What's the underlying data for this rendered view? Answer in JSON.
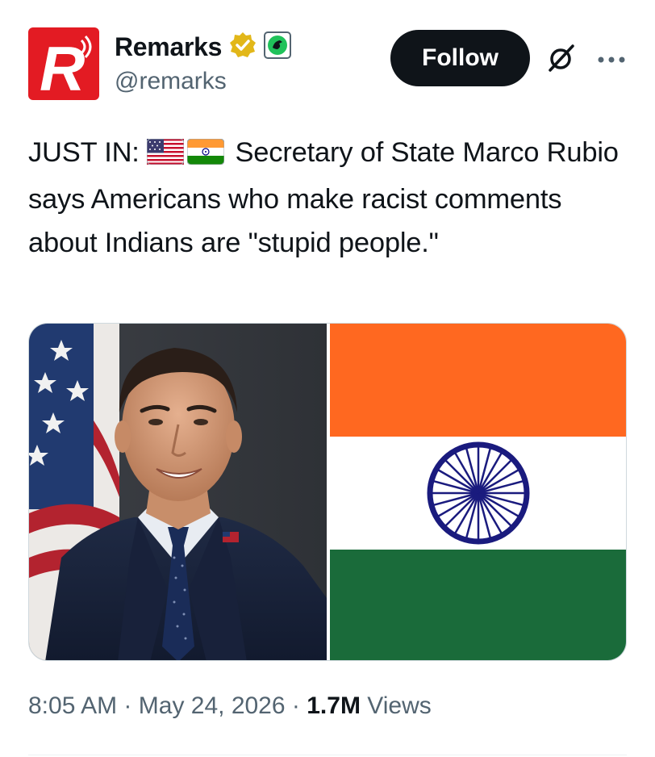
{
  "author": {
    "display_name": "Remarks",
    "handle": "@remarks",
    "avatar_letter": "R"
  },
  "actions": {
    "follow_label": "Follow",
    "grok_icon": "grok-slash-icon",
    "more_icon": "more-dots-icon"
  },
  "tweet": {
    "prefix": "JUST IN:",
    "body": "Secretary of State Marco Rubio says Americans who make racist comments about Indians are \"stupid people.\"",
    "flags": [
      "us-flag-icon",
      "india-flag-icon"
    ]
  },
  "media": {
    "left": "portrait photo",
    "right": "india-flag"
  },
  "meta": {
    "time": "8:05 AM",
    "separator": "·",
    "date": "May 24, 2026",
    "views_count": "1.7M",
    "views_label": "Views"
  },
  "colors": {
    "brand_red": "#e31b23",
    "follow_bg": "#0f1419",
    "secondary_text": "#536471",
    "verified_gold": "#e2b719",
    "saffron": "#ff6820",
    "india_green": "#138808",
    "chakra_blue": "#000080"
  }
}
